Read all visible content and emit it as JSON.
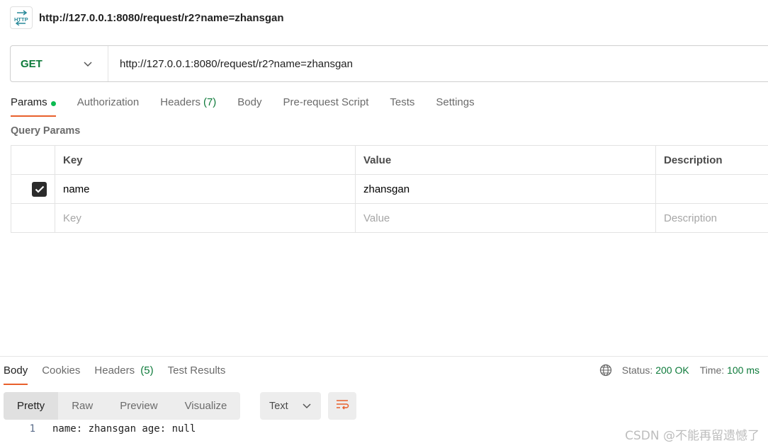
{
  "request": {
    "title": "http://127.0.0.1:8080/request/r2?name=zhansgan",
    "icon": "http-icon",
    "method": "GET",
    "url": "http://127.0.0.1:8080/request/r2?name=zhansgan"
  },
  "tabs": {
    "params": "Params",
    "authorization": "Authorization",
    "headers": "Headers",
    "headers_count": "(7)",
    "body": "Body",
    "prerequest": "Pre-request Script",
    "tests": "Tests",
    "settings": "Settings"
  },
  "query_params": {
    "title": "Query Params",
    "columns": {
      "key": "Key",
      "value": "Value",
      "description": "Description"
    },
    "rows": [
      {
        "checked": true,
        "key": "name",
        "value": "zhansgan",
        "description": ""
      }
    ],
    "placeholders": {
      "key": "Key",
      "value": "Value",
      "description": "Description"
    }
  },
  "response": {
    "tabs": {
      "body": "Body",
      "cookies": "Cookies",
      "headers": "Headers",
      "headers_count": "(5)",
      "test_results": "Test Results"
    },
    "status_label": "Status:",
    "status_value": "200 OK",
    "time_label": "Time:",
    "time_value": "100 ms",
    "views": {
      "pretty": "Pretty",
      "raw": "Raw",
      "preview": "Preview",
      "visualize": "Visualize"
    },
    "format": "Text",
    "lines": [
      {
        "no": "1",
        "text": "name: zhansgan age: null"
      }
    ]
  },
  "watermark": "CSDN @不能再留遗憾了",
  "colors": {
    "accent": "#e8602c",
    "method_green": "#0d7a3a",
    "dot_green": "#0cbb52"
  }
}
